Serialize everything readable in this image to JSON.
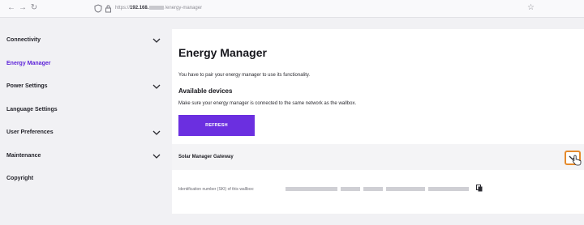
{
  "browser": {
    "back_icon": "←",
    "forward_icon": "→",
    "reload_icon": "↻",
    "url_prefix": "https://",
    "url_host": "192.168.",
    "url_path": "/energy-manager",
    "star_icon": "☆"
  },
  "sidebar": {
    "items": [
      {
        "label": "Connectivity",
        "has_chevron": true
      },
      {
        "label": "Energy Manager",
        "has_chevron": false,
        "active": true
      },
      {
        "label": "Power Settings",
        "has_chevron": true
      },
      {
        "label": "Language Settings",
        "has_chevron": false
      },
      {
        "label": "User Preferences",
        "has_chevron": true
      },
      {
        "label": "Maintenance",
        "has_chevron": true
      },
      {
        "label": "Copyright",
        "has_chevron": false
      }
    ]
  },
  "main": {
    "title": "Energy Manager",
    "info": "You have to pair your energy manager to use its functionality.",
    "section_title": "Available devices",
    "hint": "Make sure your energy manager is connected to the same network as the wallbox.",
    "refresh_label": "REFRESH",
    "device": {
      "name": "Solar Manager Gateway"
    },
    "id_label": "Identification number (SKI) of this wallbox:"
  },
  "colors": {
    "accent": "#6b2fe0",
    "active_text": "#5a1fd8",
    "focus_ring": "#e58a2c",
    "page_bg": "#f1f1f4"
  }
}
